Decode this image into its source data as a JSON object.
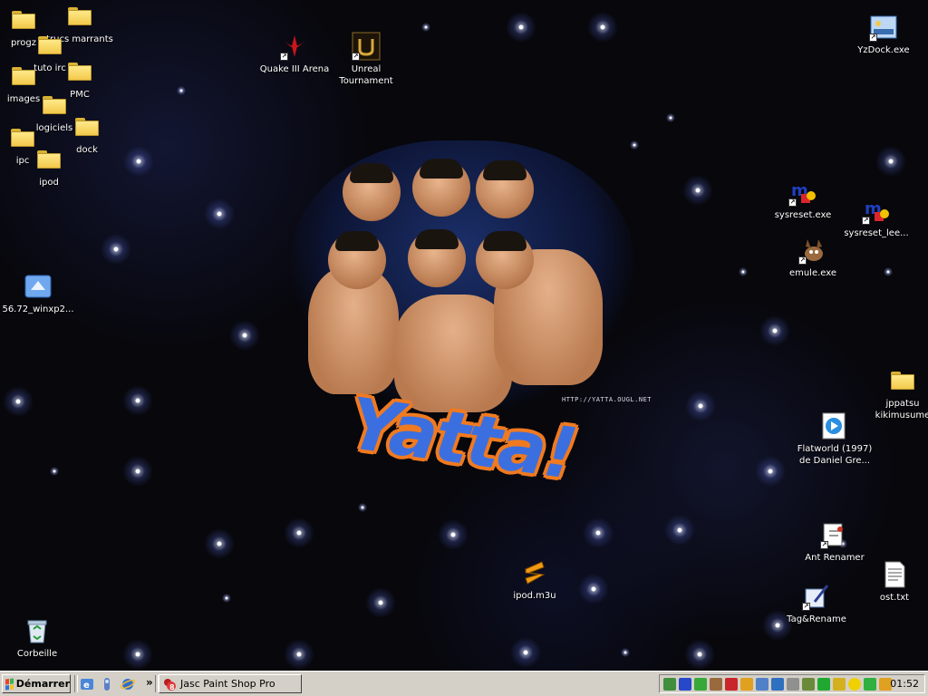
{
  "desktop": {
    "icons": {
      "progz": "progz",
      "trucs_marrants": "trucs marrants",
      "tuto_irc": "tuto irc",
      "pmc": "PMC",
      "images": "images",
      "logiciels": "logiciels",
      "dock": "dock",
      "ipc": "ipc",
      "ipod": "ipod",
      "winxp": "56.72_winxp2...",
      "corbeille": "Corbeille",
      "quake": "Quake III Arena",
      "unreal": "Unreal Tournament",
      "ipod_m3u": "ipod.m3u",
      "yzdock": "YzDock.exe",
      "sysreset": "sysreset.exe",
      "sysreset_lee": "sysreset_lee...",
      "emule": "emule.exe",
      "jppatsu": "jppatsu kikimusume",
      "flatworld": "Flatworld (1997) de Daniel Gre...",
      "ant_renamer": "Ant Renamer",
      "ost": "ost.txt",
      "tag_rename": "Tag&Rename"
    },
    "wallpaper": {
      "logo_text": "Yatta!",
      "url_text": "HTTP://YATTA.OUGL.NET"
    }
  },
  "taskbar": {
    "start_label": "Démarrer",
    "chevron": "»",
    "task_label": "Jasc Paint Shop Pro",
    "clock": "01:52"
  },
  "colors": {
    "folder": "#f2c94b",
    "taskbar": "#d4d0c8",
    "logo_fill": "#3b6fe0",
    "logo_outline": "#f07a20"
  }
}
